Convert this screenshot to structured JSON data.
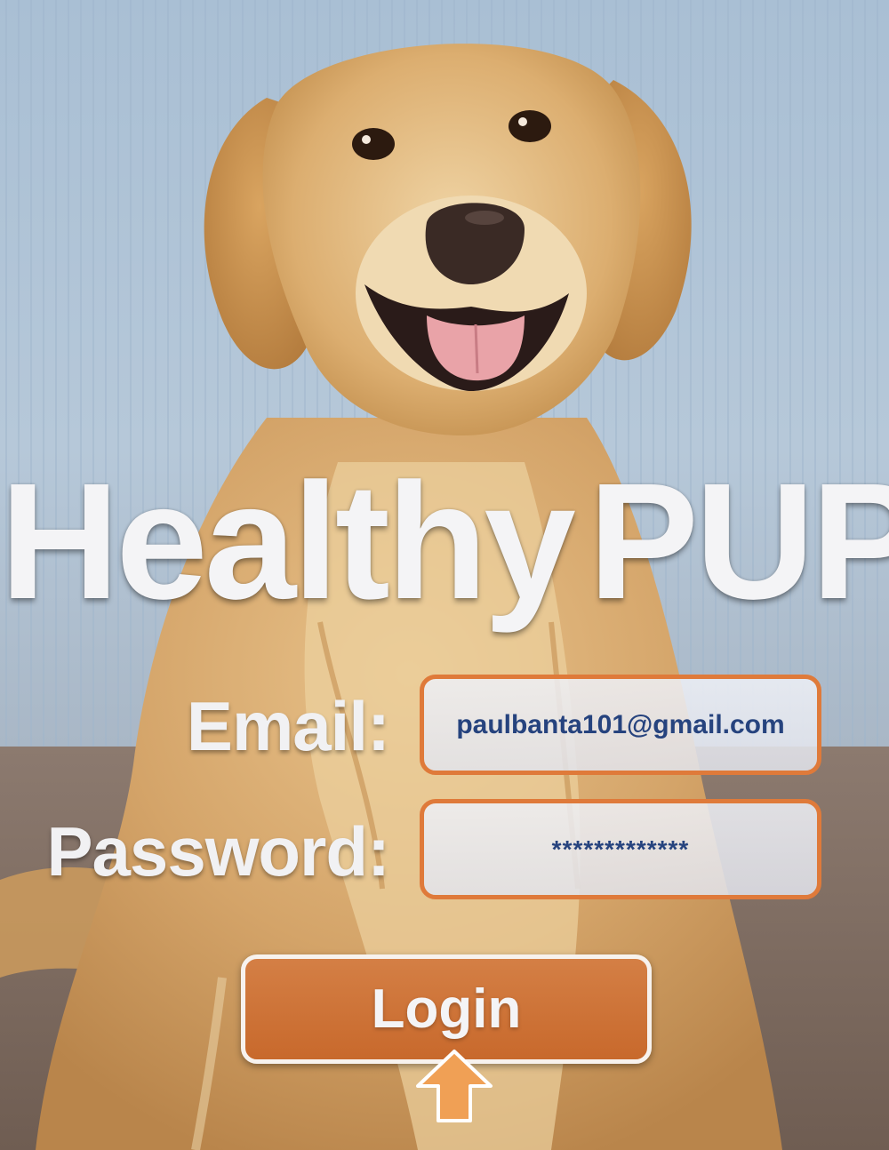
{
  "app": {
    "title_word1": "Healthy",
    "title_word2": "PUP"
  },
  "form": {
    "email_label": "Email:",
    "email_value": "paulbanta101@gmail.com",
    "password_label": "Password:",
    "password_value": "*************",
    "login_label": "Login"
  },
  "icons": {
    "pointer": "up-arrow-icon",
    "background": "golden-retriever-photo"
  },
  "colors": {
    "accent": "#df7a3a",
    "button": "#cc6f33",
    "field_text": "#26437e",
    "arrow": "#f0a055"
  }
}
